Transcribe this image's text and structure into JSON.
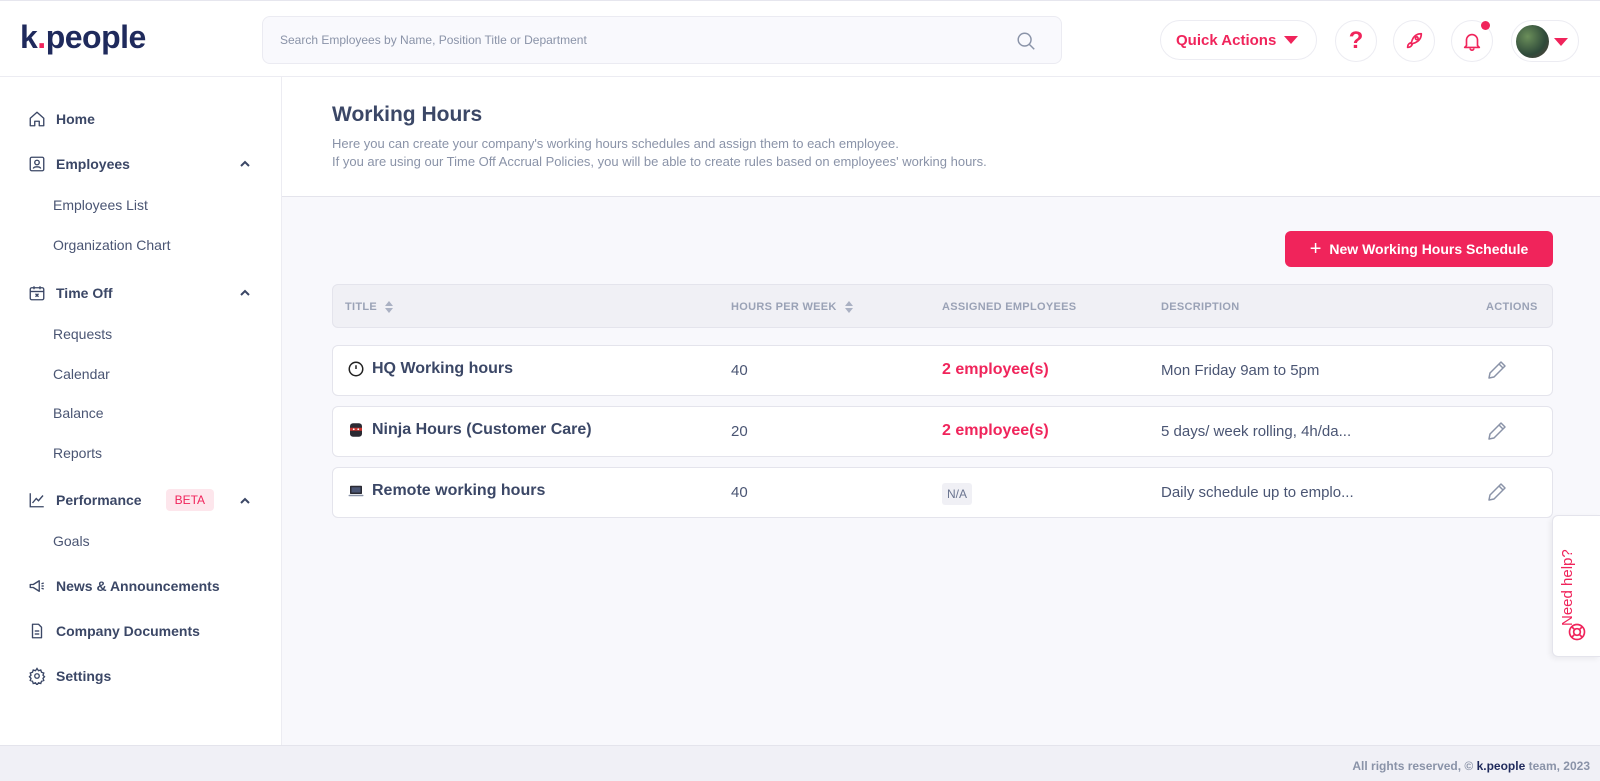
{
  "brand": {
    "prefix": "k",
    "dot": ".",
    "suffix": "people"
  },
  "header": {
    "search_placeholder": "Search Employees by Name, Position Title or Department",
    "quick_actions": "Quick Actions",
    "help": "?"
  },
  "sidebar": {
    "home": "Home",
    "employees": "Employees",
    "employees_list": "Employees List",
    "org_chart": "Organization Chart",
    "time_off": "Time Off",
    "requests": "Requests",
    "calendar": "Calendar",
    "balance": "Balance",
    "reports": "Reports",
    "performance": "Performance",
    "beta": "BETA",
    "goals": "Goals",
    "news": "News & Announcements",
    "documents": "Company Documents",
    "settings": "Settings"
  },
  "page": {
    "title": "Working Hours",
    "desc1": "Here you can create your company's working hours schedules and assign them to each employee.",
    "desc2": "If you are using our Time Off Accrual Policies, you will be able to create rules based on employees' working hours.",
    "new_button": "New Working Hours Schedule"
  },
  "table": {
    "columns": {
      "title": "TITLE",
      "hours": "HOURS PER WEEK",
      "assigned": "ASSIGNED EMPLOYEES",
      "description": "DESCRIPTION",
      "actions": "ACTIONS"
    },
    "rows": [
      {
        "emoji": "🕛",
        "title": "HQ Working hours",
        "hours": "40",
        "assigned": "2 employee(s)",
        "description": "Mon Friday 9am to 5pm"
      },
      {
        "emoji": "🥷",
        "title": "Ninja Hours (Customer Care)",
        "hours": "20",
        "assigned": "2 employee(s)",
        "description": "5 days/ week rolling, 4h/da..."
      },
      {
        "emoji": "💻",
        "title": "Remote working hours",
        "hours": "40",
        "assigned": "N/A",
        "description": "Daily schedule up to emplo..."
      }
    ]
  },
  "need_help": "Need help?",
  "footer": {
    "prefix": "All rights reserved, © ",
    "brand": "k.people",
    "suffix": " team, 2023"
  },
  "colors": {
    "accent": "#f0245b",
    "navy": "#1f2a5c"
  }
}
